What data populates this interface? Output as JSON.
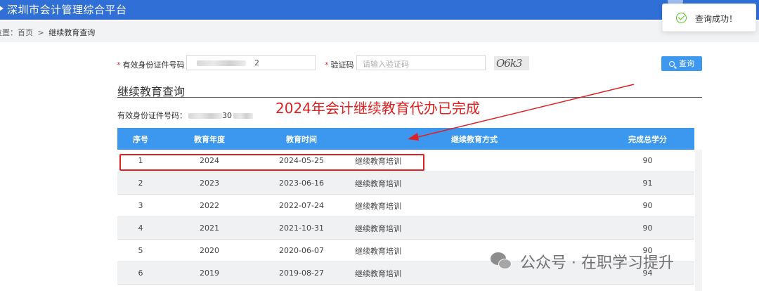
{
  "header": {
    "title": "深圳市会计管理综合平台"
  },
  "breadcrumb": {
    "prefix": "位置：",
    "home": "首页",
    "separator": ">",
    "current": "继续教育查询"
  },
  "toast": {
    "message": "查询成功！",
    "status_color": "#52c41a"
  },
  "form": {
    "id_label": "有效身份证件号码",
    "id_value_start": "",
    "id_value_end": "2",
    "captcha_label": "验证码",
    "captcha_placeholder": "请输入验证码",
    "captcha_image_text": "O6k3",
    "search_button": "查询"
  },
  "section": {
    "title": "继续教育查询",
    "id_line_label": "有效身份证件号码：",
    "id_line_value_end": "30"
  },
  "annotation": {
    "text": "2024年会计继续教育代办已完成",
    "color": "#e02020"
  },
  "table": {
    "columns": [
      "序号",
      "教育年度",
      "教育时间",
      "继续教育方式",
      "完成总学分"
    ],
    "header_color": "#3c97ee",
    "rows": [
      {
        "no": "1",
        "year": "2024",
        "date": "2024-05-25",
        "method": "继续教育培训",
        "credits": "90"
      },
      {
        "no": "2",
        "year": "2023",
        "date": "2023-06-16",
        "method": "继续教育培训",
        "credits": "91"
      },
      {
        "no": "3",
        "year": "2022",
        "date": "2022-07-24",
        "method": "继续教育培训",
        "credits": "90"
      },
      {
        "no": "4",
        "year": "2021",
        "date": "2021-10-31",
        "method": "继续教育培训",
        "credits": "90"
      },
      {
        "no": "5",
        "year": "2020",
        "date": "2020-06-07",
        "method": "继续教育培训",
        "credits": "90"
      },
      {
        "no": "6",
        "year": "2019",
        "date": "2019-08-27",
        "method": "继续教育培训",
        "credits": "94"
      }
    ]
  },
  "watermark": {
    "text": "公众号 · 在职学习提升",
    "icon": "wechat-icon"
  }
}
